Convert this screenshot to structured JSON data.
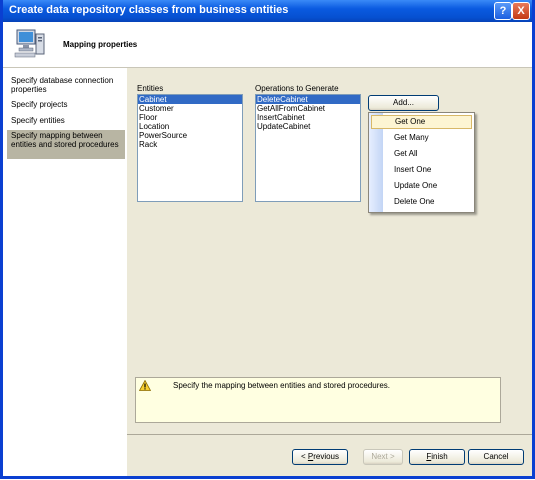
{
  "window": {
    "title": "Create data repository classes from business entities",
    "help_label": "?",
    "close_label": "X"
  },
  "header": {
    "title": "Mapping properties",
    "icon": "computer-monitor-icon"
  },
  "sidebar": {
    "items": [
      {
        "label": "Specify database connection properties",
        "selected": false
      },
      {
        "label": "Specify projects",
        "selected": false
      },
      {
        "label": "Specify entities",
        "selected": false
      },
      {
        "label": "Specify mapping between entities and stored procedures",
        "selected": true
      }
    ]
  },
  "entities": {
    "label": "Entities",
    "items": [
      "Cabinet",
      "Customer",
      "Floor",
      "Location",
      "PowerSource",
      "Rack"
    ],
    "selected": "Cabinet"
  },
  "operations": {
    "label": "Operations to Generate",
    "items": [
      "DeleteCabinet",
      "GetAllFromCabinet",
      "InsertCabinet",
      "UpdateCabinet"
    ],
    "selected": "DeleteCabinet"
  },
  "add_button": {
    "label": "Add..."
  },
  "add_menu": {
    "items": [
      "Get One",
      "Get Many",
      "Get All",
      "Insert One",
      "Update One",
      "Delete One"
    ],
    "highlighted": "Get One"
  },
  "info": {
    "icon": "warning-icon",
    "text": "Specify the mapping between entities and stored procedures."
  },
  "footer": {
    "previous_prefix": "< ",
    "previous_mnemonic": "P",
    "previous_rest": "revious",
    "next_label": "Next >",
    "finish_mnemonic": "F",
    "finish_rest": "inish",
    "cancel_label": "Cancel"
  },
  "colors": {
    "titlebar": "#0a5ae0",
    "selection": "#316ac5",
    "panel": "#ece9d8",
    "info_background": "#ffffe1"
  }
}
